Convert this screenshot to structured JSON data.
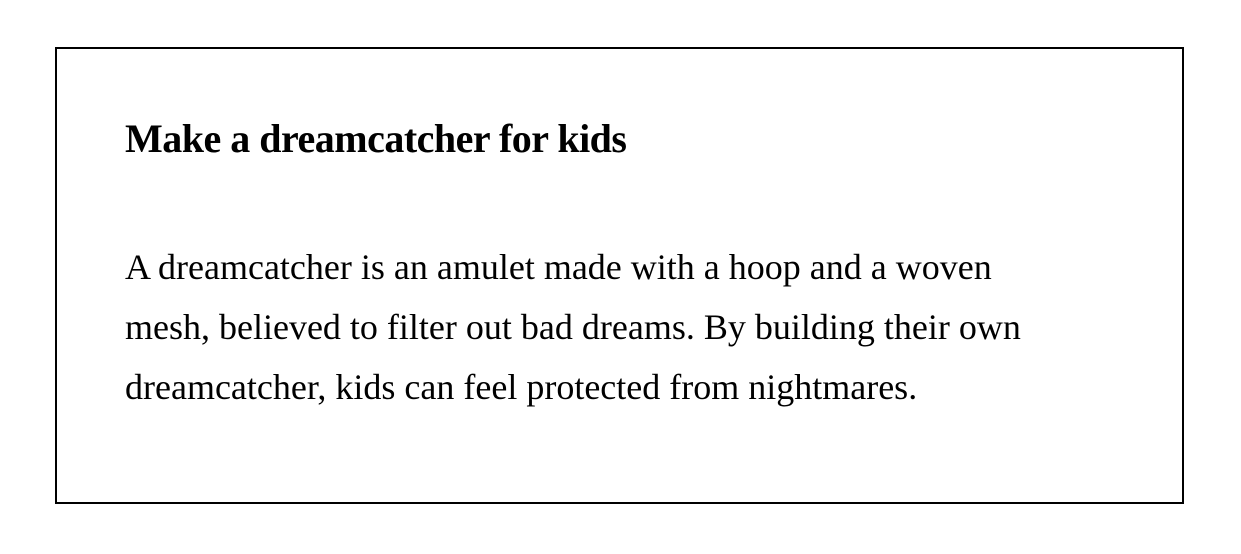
{
  "card": {
    "title": "Make a dreamcatcher for kids",
    "body_lines": [
      "A dreamcatcher is an amulet made with a hoop and a woven",
      "mesh, believed to filter out bad dreams. By building their own",
      "dreamcatcher, kids can feel protected from nightmares."
    ]
  },
  "colors": {
    "text": "#000000",
    "border": "#000000",
    "background": "#ffffff"
  }
}
